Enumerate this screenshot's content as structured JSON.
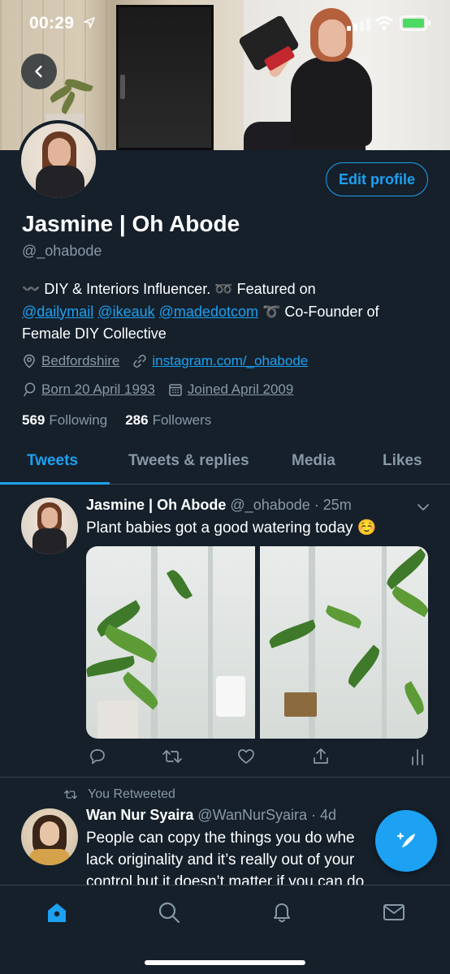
{
  "status_bar": {
    "time": "00:29"
  },
  "profile": {
    "edit_profile_label": "Edit profile",
    "display_name": "Jasmine | Oh Abode",
    "handle": "@_ohabode",
    "bio": {
      "line1_sym": "〰️",
      "line1_text": " DIY & Interiors Influencer. ",
      "line1_sym2": "➿",
      "line1_text2": " Featured on",
      "mention1": "@dailymail",
      "mention2": "@ikeauk",
      "mention3": "@madedotcom",
      "line2_sym": " ➰",
      "line2_text": " Co-Founder of",
      "line3_text": "Female DIY Collective"
    },
    "location": "Bedfordshire",
    "website": "instagram.com/_ohabode",
    "birthday": "Born 20 April 1993",
    "joined": "Joined April 2009",
    "following_count": "569",
    "following_label": "Following",
    "followers_count": "286",
    "followers_label": "Followers"
  },
  "tabs": [
    {
      "label": "Tweets",
      "active": true
    },
    {
      "label": "Tweets & replies",
      "active": false
    },
    {
      "label": "Media",
      "active": false
    },
    {
      "label": "Likes",
      "active": false
    }
  ],
  "tweets": [
    {
      "name": "Jasmine | Oh Abode",
      "meta": " @_ohabode · 25m",
      "text": "Plant babies got a good watering today ☺️"
    },
    {
      "retweet_label": "You Retweeted",
      "name": "Wan Nur Syaira",
      "meta": " @WanNurSyaira · 4d",
      "text_line1": "People can copy the things you do whe",
      "text_line2": "lack originality and it’s really out of your",
      "text_line3": "control but it doesn’t matter if you can do"
    }
  ],
  "colors": {
    "accent": "#1da1f2",
    "background": "#15202b",
    "muted": "#8899a6",
    "divider": "#38444d"
  }
}
